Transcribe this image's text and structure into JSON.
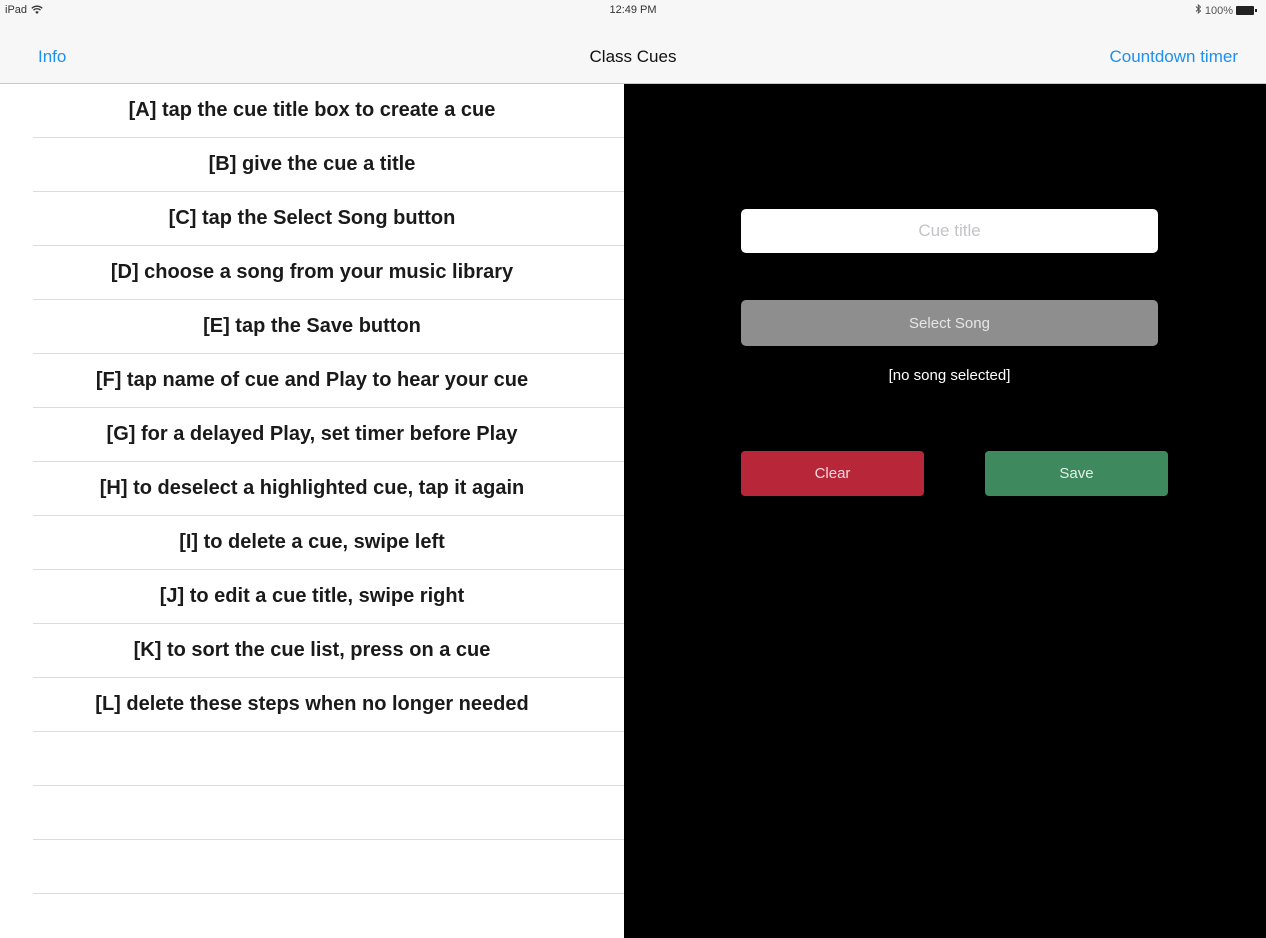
{
  "status_bar": {
    "device": "iPad",
    "time": "12:49 PM",
    "battery": "100%",
    "icons": [
      "wifi-icon",
      "bluetooth-icon",
      "battery-icon"
    ]
  },
  "nav": {
    "left_label": "Info",
    "title": "Class Cues",
    "right_label": "Countdown timer",
    "accent_color": "#1e8ff0"
  },
  "cue_list": {
    "items": [
      "[A] tap the cue title box to create a cue",
      "[B] give the cue a title",
      "[C] tap the Select Song button",
      "[D] choose a song from your music library",
      "[E] tap the Save button",
      "[F] tap name of cue and Play to hear your cue",
      "[G] for a delayed Play, set timer before Play",
      "[H] to deselect a highlighted cue, tap it again",
      "[I] to delete a cue, swipe left",
      "[J] to edit a cue title, swipe right",
      "[K] to sort the cue list, press on a cue",
      "[L] delete these steps when no longer needed"
    ]
  },
  "editor": {
    "cue_title_placeholder": "Cue title",
    "cue_title_value": "",
    "select_song_label": "Select Song",
    "song_status": "[no song selected]",
    "clear_label": "Clear",
    "save_label": "Save",
    "clear_color": "#b8263a",
    "save_color": "#3e8a5e"
  }
}
